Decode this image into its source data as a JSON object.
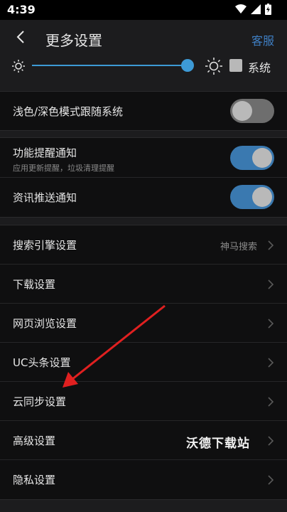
{
  "status_bar": {
    "time": "4:39"
  },
  "header": {
    "back_icon": "chevron-left-icon",
    "title": "更多设置",
    "action_label": "客服",
    "accent_color": "#3f7fc4"
  },
  "brightness": {
    "low_icon": "sun-small-icon",
    "high_icon": "sun-large-icon",
    "level_percent": 100,
    "system_label": "系统",
    "system_checked": false
  },
  "theme_group": {
    "items": [
      {
        "label": "浅色/深色模式跟随系统",
        "toggle": false
      }
    ]
  },
  "notify_group": {
    "items": [
      {
        "label": "功能提醒通知",
        "sub": "应用更新提醒，垃圾清理提醒",
        "toggle": true
      },
      {
        "label": "资讯推送通知",
        "toggle": true
      }
    ]
  },
  "settings_group": {
    "items": [
      {
        "label": "搜索引擎设置",
        "value": "神马搜索"
      },
      {
        "label": "下载设置"
      },
      {
        "label": "网页浏览设置"
      },
      {
        "label": "UC头条设置"
      },
      {
        "label": "云同步设置"
      },
      {
        "label": "高级设置"
      },
      {
        "label": "隐私设置"
      }
    ]
  },
  "watermark": {
    "text": "沃德下载站"
  },
  "annotation": {
    "arrow_color": "#e02020",
    "target": "云同步设置"
  }
}
